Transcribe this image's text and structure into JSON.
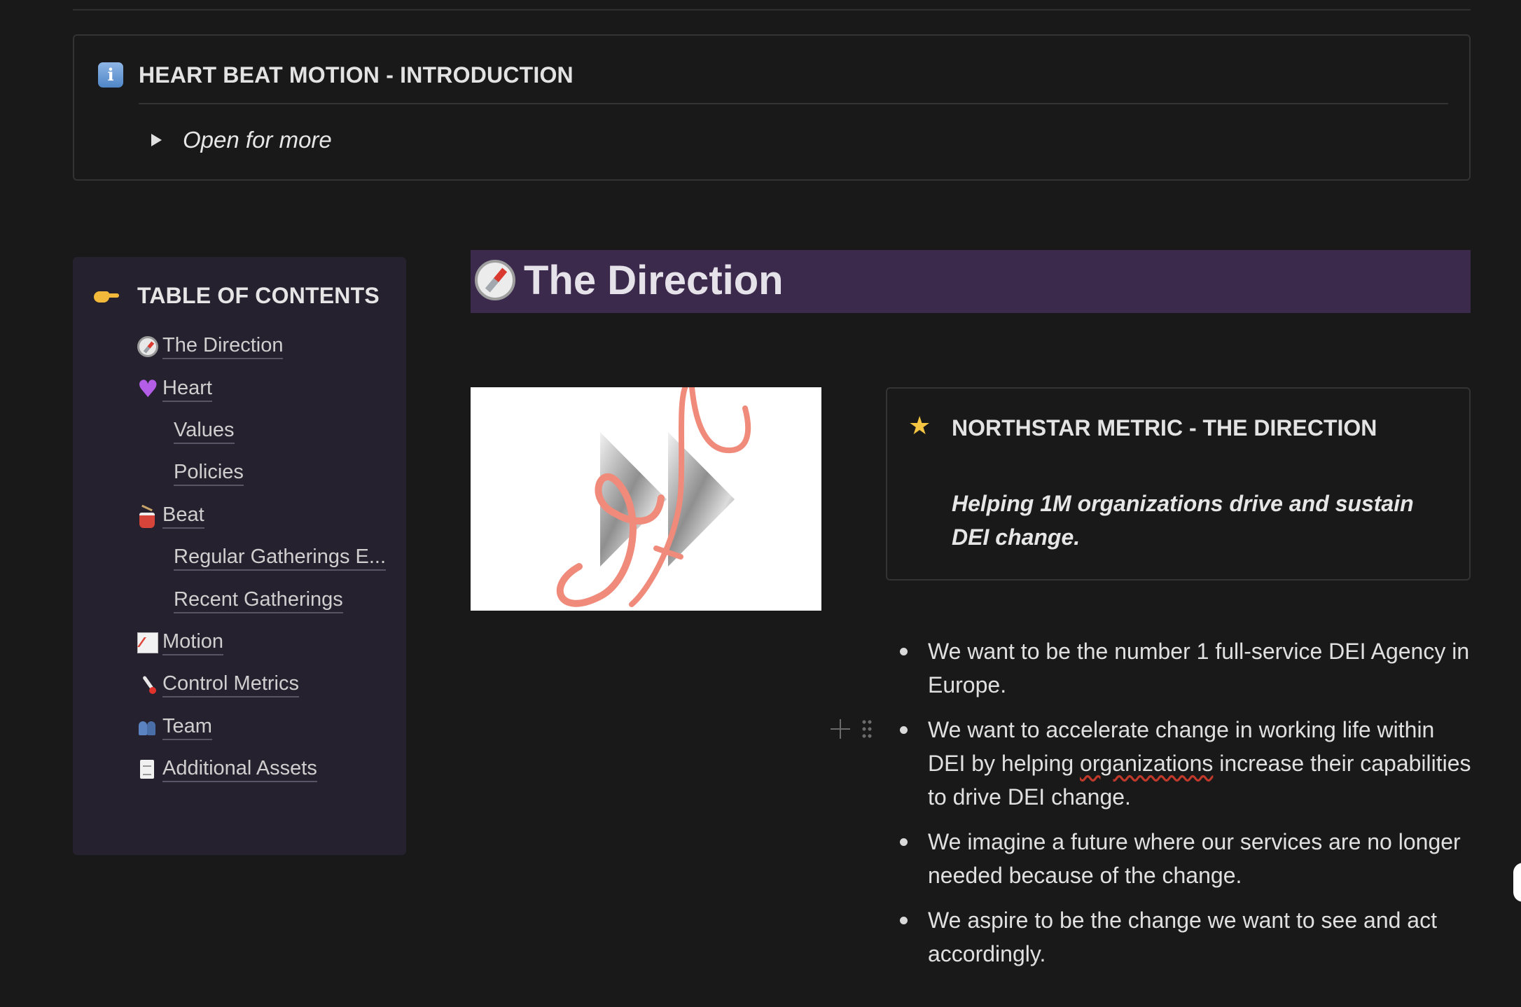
{
  "intro_callout": {
    "icon": "information-icon",
    "title": "HEART BEAT MOTION - INTRODUCTION",
    "toggle_label": "Open for more"
  },
  "toc": {
    "header_icon": "pointing-hand-icon",
    "title": "TABLE OF CONTENTS",
    "items": [
      {
        "label": "The Direction",
        "icon": "compass-icon",
        "level": 1
      },
      {
        "label": "Heart",
        "icon": "purple-heart-icon",
        "level": 1
      },
      {
        "label": "Values",
        "icon": "",
        "level": 2
      },
      {
        "label": "Policies",
        "icon": "",
        "level": 2
      },
      {
        "label": "Beat",
        "icon": "drum-icon",
        "level": 1
      },
      {
        "label": "Regular Gatherings E...",
        "icon": "",
        "level": 2
      },
      {
        "label": "Recent Gatherings",
        "icon": "",
        "level": 2
      },
      {
        "label": "Motion",
        "icon": "chart-increasing-icon",
        "level": 1
      },
      {
        "label": "Control Metrics",
        "icon": "thermometer-icon",
        "level": 1
      },
      {
        "label": "Team",
        "icon": "people-icon",
        "level": 1
      },
      {
        "label": "Additional Assets",
        "icon": "document-icon",
        "level": 1
      }
    ]
  },
  "direction": {
    "icon": "compass-icon",
    "title": "The Direction",
    "background": "#3c2a4d"
  },
  "northstar": {
    "icon": "glowing-star-icon",
    "title": "NORTHSTAR METRIC - THE DIRECTION",
    "text": "Helping 1M organizations drive and sustain DEI change."
  },
  "bullets": [
    {
      "text": "We want to be the number 1 full-service DEI Agency in Europe."
    },
    {
      "pre": "We want to accelerate change in working life within DEI by helping ",
      "flagged": "organizations",
      "post": " increase their capabilities to drive DEI change."
    },
    {
      "text": "We imagine a future where our services are no longer needed because of the change."
    },
    {
      "text": "We aspire to be the change we want to see and act accordingly."
    }
  ],
  "colors": {
    "background": "#191919",
    "toc_background": "#25212e",
    "heading_background": "#3c2a4d",
    "image_accent": "#f08a7a"
  }
}
